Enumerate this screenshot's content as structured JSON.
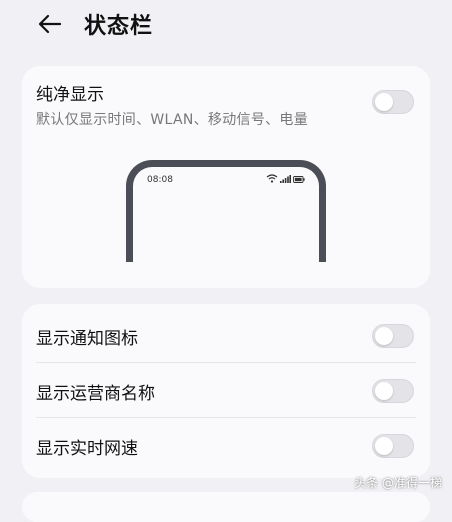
{
  "header": {
    "back_icon": "arrow-left-icon",
    "title": "状态栏"
  },
  "pure_display": {
    "title": "纯净显示",
    "subtitle": "默认仅显示时间、WLAN、移动信号、电量",
    "enabled": false
  },
  "preview": {
    "time": "08:08",
    "icons": [
      "wifi-icon",
      "signal-icon",
      "battery-icon"
    ]
  },
  "settings": [
    {
      "label": "显示通知图标",
      "enabled": false
    },
    {
      "label": "显示运营商名称",
      "enabled": false
    },
    {
      "label": "显示实时网速",
      "enabled": false
    }
  ],
  "colors": {
    "background": "#f1f1f5",
    "card": "#fafafc",
    "toggle_off": "#e3e3e8",
    "phone_frame": "#4b4e57"
  },
  "watermark": {
    "text": "头条 @准得一梯"
  }
}
